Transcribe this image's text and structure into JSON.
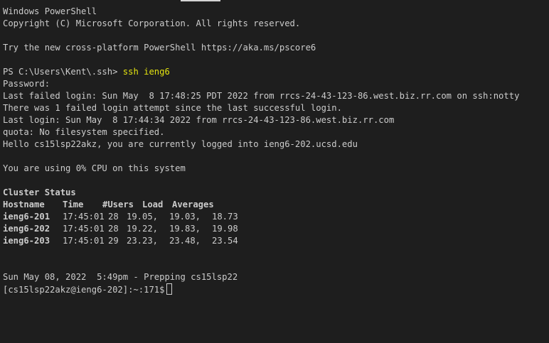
{
  "header": {
    "title": "Windows PowerShell",
    "copyright": "Copyright (C) Microsoft Corporation. All rights reserved.",
    "tip": "Try the new cross-platform PowerShell https://aka.ms/pscore6"
  },
  "session": {
    "prompt": "PS C:\\Users\\Kent\\.ssh> ",
    "command": "ssh ieng6",
    "password_label": "Password:",
    "last_failed": "Last failed login: Sun May  8 17:48:25 PDT 2022 from rrcs-24-43-123-86.west.biz.rr.com on ssh:notty",
    "failed_count": "There was 1 failed login attempt since the last successful login.",
    "last_login": "Last login: Sun May  8 17:44:34 2022 from rrcs-24-43-123-86.west.biz.rr.com",
    "quota": "quota: No filesystem specified.",
    "hello": "Hello cs15lsp22akz, you are currently logged into ieng6-202.ucsd.edu",
    "cpu": "You are using 0% CPU on this system"
  },
  "cluster": {
    "title": "Cluster Status",
    "headers": {
      "hostname": "Hostname",
      "time": "Time",
      "users": "#Users",
      "load": "Load",
      "averages": "Averages"
    },
    "rows": [
      {
        "host": "ieng6-201",
        "time": "17:45:01",
        "users": "28",
        "l1": "19.05,",
        "l2": "19.03,",
        "l3": "18.73"
      },
      {
        "host": "ieng6-202",
        "time": "17:45:01",
        "users": "28",
        "l1": "19.22,",
        "l2": "19.83,",
        "l3": "19.98"
      },
      {
        "host": "ieng6-203",
        "time": "17:45:01",
        "users": "29",
        "l1": "23.23,",
        "l2": "23.48,",
        "l3": "23.54"
      }
    ]
  },
  "footer": {
    "prep": "Sun May 08, 2022  5:49pm - Prepping cs15lsp22",
    "prompt": "[cs15lsp22akz@ieng6-202]:~:171$"
  },
  "colors": {
    "background": "#1e1e1e",
    "text": "#cccccc",
    "command": "#e5e510"
  }
}
